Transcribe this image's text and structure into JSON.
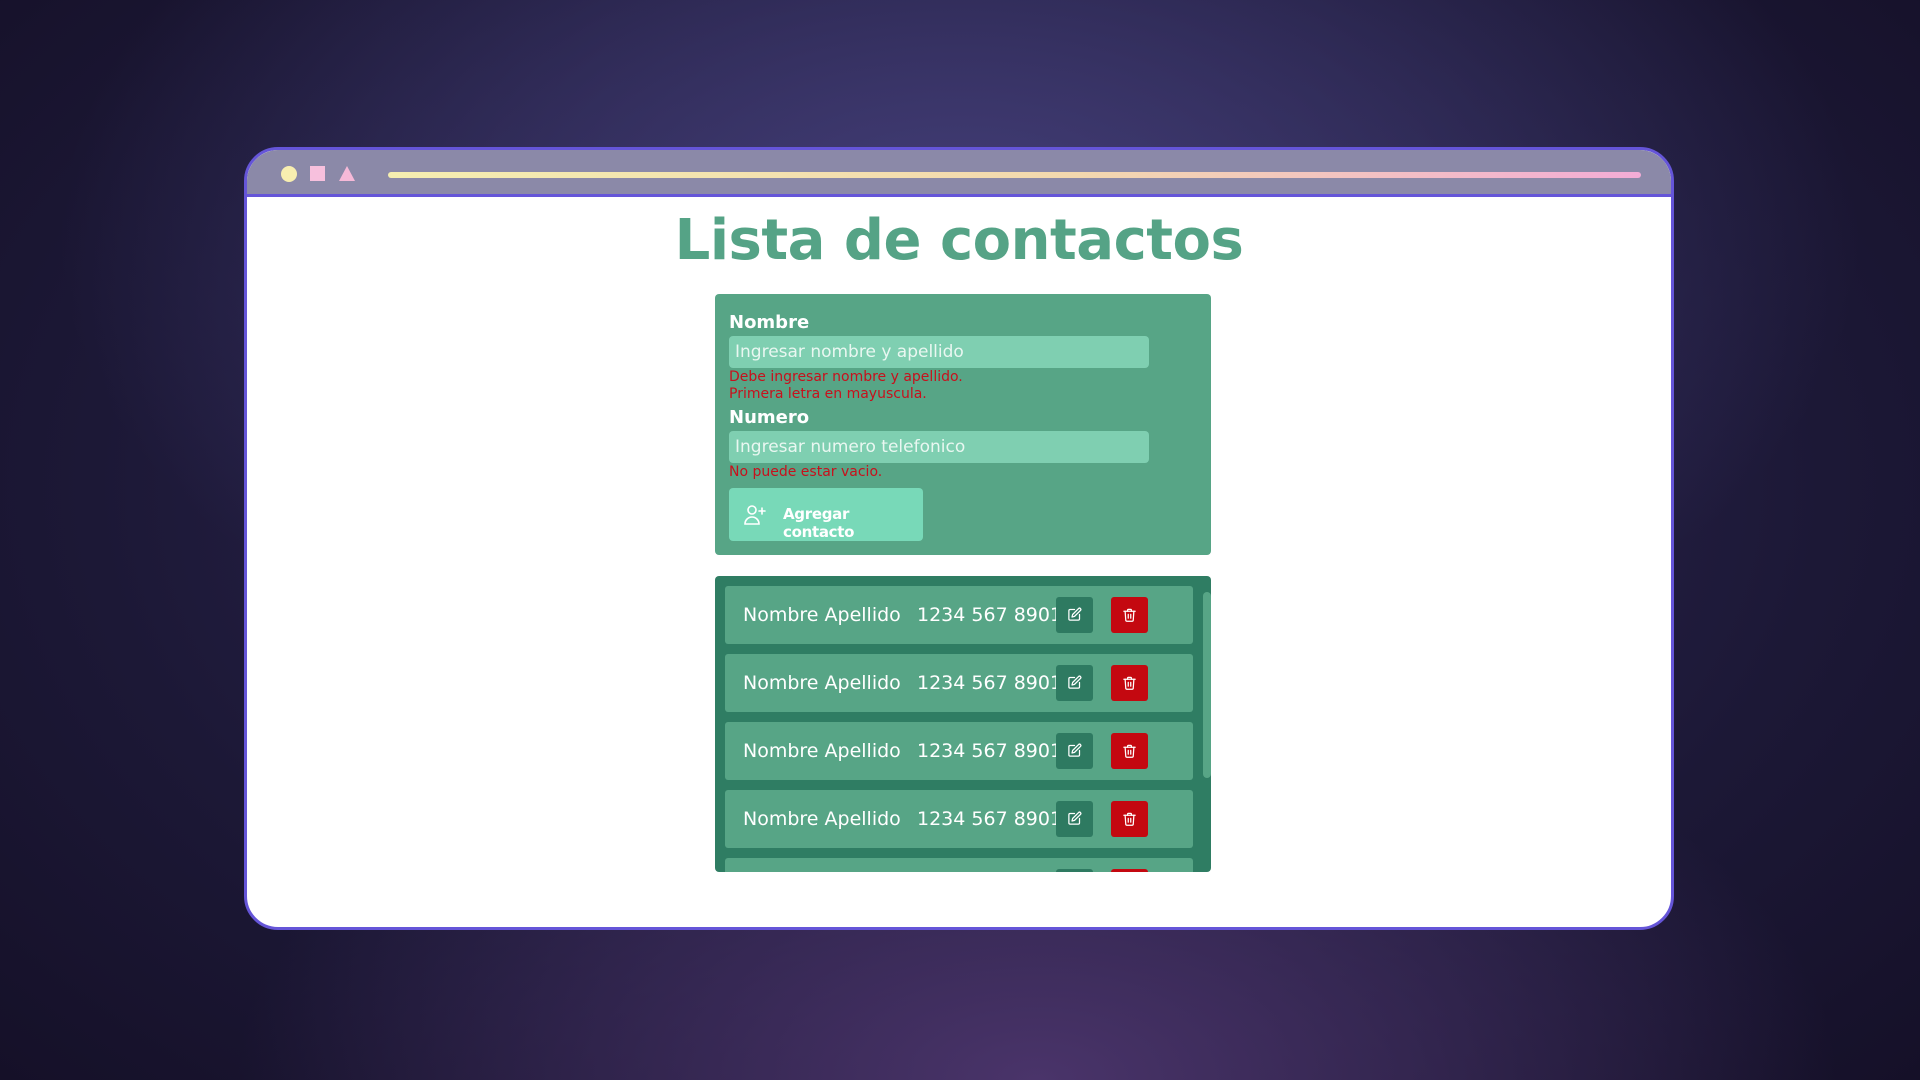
{
  "colors": {
    "window_border": "#6555d8",
    "title_green": "#55a386",
    "card_green": "#57a586",
    "list_dark_green": "#2f7d63",
    "input_green": "#7fcfb1",
    "button_green": "#78d9b8",
    "error_red": "#c8101c",
    "delete_red": "#c40810",
    "dot_yellow": "#f8eeb0",
    "square_pink": "#f7c0dd",
    "triangle_pink": "#f6b9d8"
  },
  "page": {
    "title": "Lista de contactos"
  },
  "form": {
    "name_label": "Nombre",
    "name_placeholder": "Ingresar nombre y apellido",
    "name_error_1": "Debe ingresar nombre y apellido.",
    "name_error_2": "Primera letra en mayuscula.",
    "number_label": "Numero",
    "number_placeholder": "Ingresar numero telefonico",
    "number_error": "No puede estar vacio.",
    "add_button_label": "Agregar contacto",
    "add_button_icon": "user-plus-icon"
  },
  "contacts": [
    {
      "name": "Nombre Apellido",
      "phone": "1234 567 8901"
    },
    {
      "name": "Nombre Apellido",
      "phone": "1234 567 8901"
    },
    {
      "name": "Nombre Apellido",
      "phone": "1234 567 8901"
    },
    {
      "name": "Nombre Apellido",
      "phone": "1234 567 8901"
    },
    {
      "name": "",
      "phone": ""
    }
  ],
  "row_icons": {
    "edit": "edit-icon",
    "delete": "trash-icon"
  }
}
